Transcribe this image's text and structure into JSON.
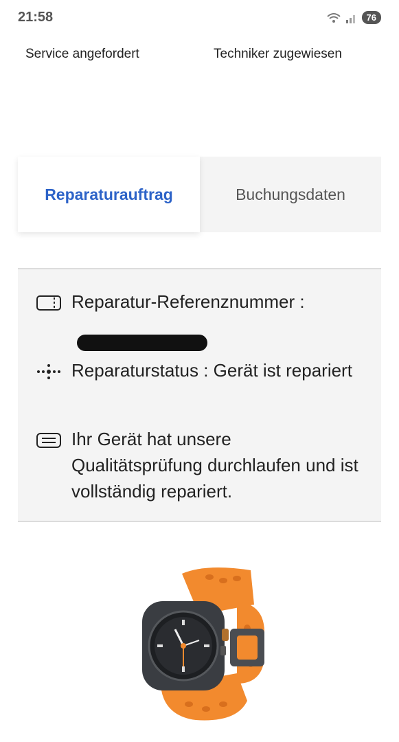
{
  "status_bar": {
    "time": "21:58",
    "battery": "76"
  },
  "progress_steps": [
    "Service angefordert",
    "Techniker zugewiesen"
  ],
  "tabs": {
    "active": "Reparaturauftrag",
    "inactive": "Buchungsdaten"
  },
  "details": {
    "reference_label": "Reparatur-Referenznummer :",
    "status_text": "Reparaturstatus : Gerät ist repariert",
    "message": "Ihr Gerät hat unsere Qualitätsprüfung durchlaufen und ist vollständig repariert."
  },
  "icons": {
    "reference": "ticket-icon",
    "status": "status-dots-icon",
    "message": "message-icon",
    "wifi": "wifi-icon",
    "signal": "signal-icon"
  },
  "colors": {
    "accent": "#2d63c8",
    "watch_band": "#f28a2e"
  }
}
